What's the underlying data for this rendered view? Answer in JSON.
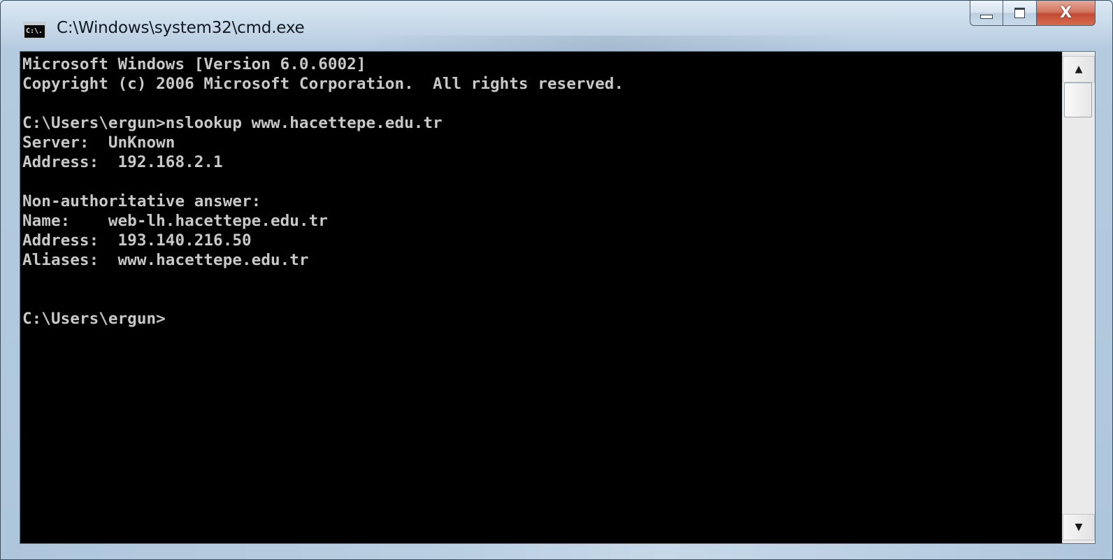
{
  "window": {
    "title": "C:\\Windows\\system32\\cmd.exe",
    "icon_label": "C:\\."
  },
  "caption_buttons": {
    "minimize": "minimize-icon",
    "maximize": "maximize-icon",
    "close_glyph": "X"
  },
  "console": {
    "background": "#000000",
    "foreground": "#c0c0c0",
    "lines": [
      "Microsoft Windows [Version 6.0.6002]",
      "Copyright (c) 2006 Microsoft Corporation.  All rights reserved.",
      "",
      "C:\\Users\\ergun>nslookup www.hacettepe.edu.tr",
      "Server:  UnKnown",
      "Address:  192.168.2.1",
      "",
      "Non-authoritative answer:",
      "Name:    web-lh.hacettepe.edu.tr",
      "Address:  193.140.216.50",
      "Aliases:  www.hacettepe.edu.tr",
      "",
      "",
      "C:\\Users\\ergun>"
    ]
  },
  "scrollbar": {
    "up_arrow": "▲",
    "down_arrow": "▼"
  }
}
